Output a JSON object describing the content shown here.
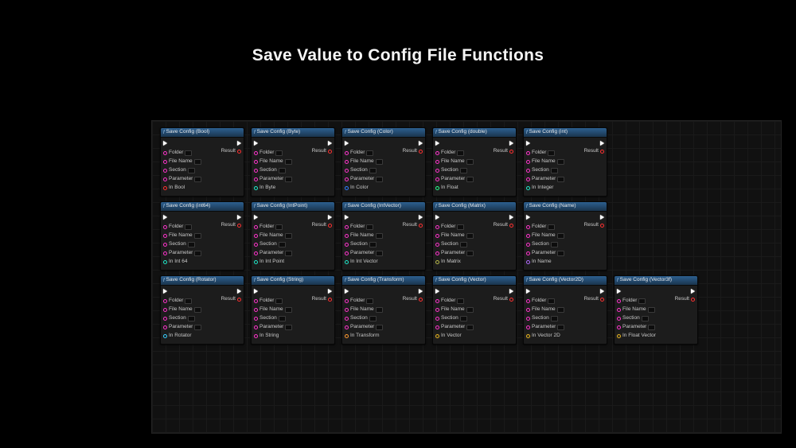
{
  "title": "Save Value to Config File Functions",
  "common_pins": {
    "folder": "Folder",
    "file_name": "File Name",
    "section": "Section",
    "parameter": "Parameter",
    "result": "Result"
  },
  "nodes": [
    {
      "title": "Save Config (Bool)",
      "in_label": "In Bool",
      "in_color": "red"
    },
    {
      "title": "Save Config (Byte)",
      "in_label": "In Byte",
      "in_color": "teal"
    },
    {
      "title": "Save Config (Color)",
      "in_label": "In Color",
      "in_color": "blue"
    },
    {
      "title": "Save Config (double)",
      "in_label": "In Float",
      "in_color": "green"
    },
    {
      "title": "Save Config (int)",
      "in_label": "In Integer",
      "in_color": "teal"
    },
    {
      "title": "Save Config (int64)",
      "in_label": "In Int 64",
      "in_color": "teal"
    },
    {
      "title": "Save Config (IntPoint)",
      "in_label": "In Int Point",
      "in_color": "teal"
    },
    {
      "title": "Save Config (IntVector)",
      "in_label": "In Int Vector",
      "in_color": "teal"
    },
    {
      "title": "Save Config (Matrix)",
      "in_label": "In Matrix",
      "in_color": "olive"
    },
    {
      "title": "Save Config (Name)",
      "in_label": "In Name",
      "in_color": "purple"
    },
    {
      "title": "Save Config (Rotator)",
      "in_label": "In Rotator",
      "in_color": "cyan"
    },
    {
      "title": "Save Config (String)",
      "in_label": "In String",
      "in_color": "magenta"
    },
    {
      "title": "Save Config (Transform)",
      "in_label": "In Transform",
      "in_color": "orange"
    },
    {
      "title": "Save Config (Vector)",
      "in_label": "In Vector",
      "in_color": "gold"
    },
    {
      "title": "Save Config (Vector2D)",
      "in_label": "In Vector 2D",
      "in_color": "gold"
    },
    {
      "title": "Save Config (Vector3f)",
      "in_label": "In Float Vector",
      "in_color": "gold"
    }
  ]
}
